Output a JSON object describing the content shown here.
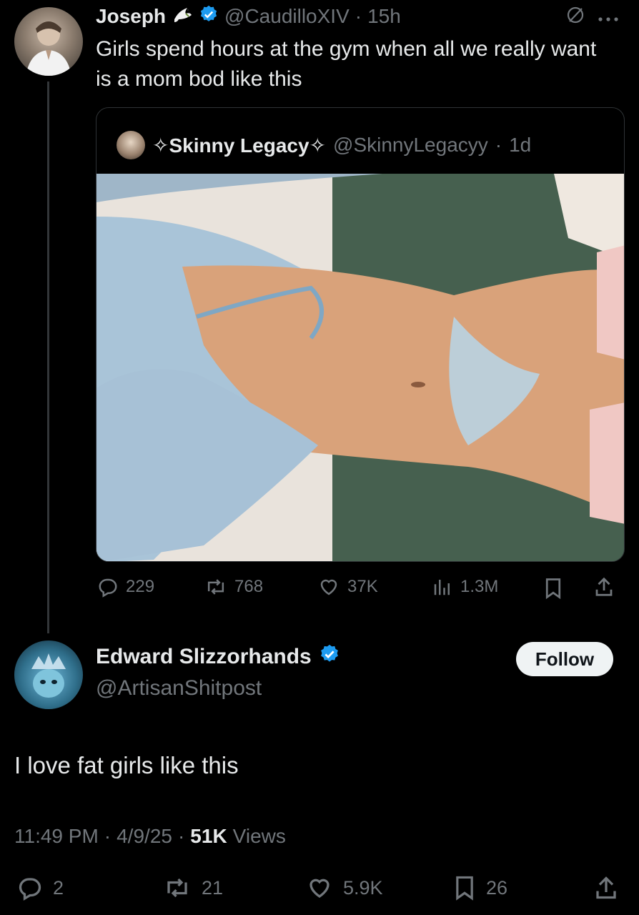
{
  "original_tweet": {
    "author_name": "Joseph",
    "handle": "@CaudilloXIV",
    "separator": "·",
    "time": "15h",
    "text": "Girls spend hours at the gym when all we really want is a mom bod like this",
    "more_icon": "ellipsis-icon",
    "dove_icon": "dove-emoji-icon"
  },
  "quoted_tweet": {
    "author_name": "✧Skinny Legacy✧",
    "handle": "@SkinnyLegacyy",
    "separator": "·",
    "time": "1d",
    "image_alt": "photo"
  },
  "original_stats": {
    "replies": "229",
    "reposts": "768",
    "likes": "37K",
    "views": "1.3M"
  },
  "reply": {
    "author_name": "Edward Slizzorhands",
    "handle": "@ArtisanShitpost",
    "follow_label": "Follow",
    "text": "I love fat girls like this",
    "time": "11:49 PM",
    "date": "4/9/25",
    "sep1": "·",
    "sep2": "·",
    "views_count": "51K",
    "views_label": "Views"
  },
  "reply_stats": {
    "replies": "2",
    "reposts": "21",
    "likes": "5.9K",
    "bookmarks": "26"
  },
  "colors": {
    "verified": "#1d9bf0",
    "background": "#000000",
    "text": "#e7e9ea",
    "muted": "#71767b"
  }
}
